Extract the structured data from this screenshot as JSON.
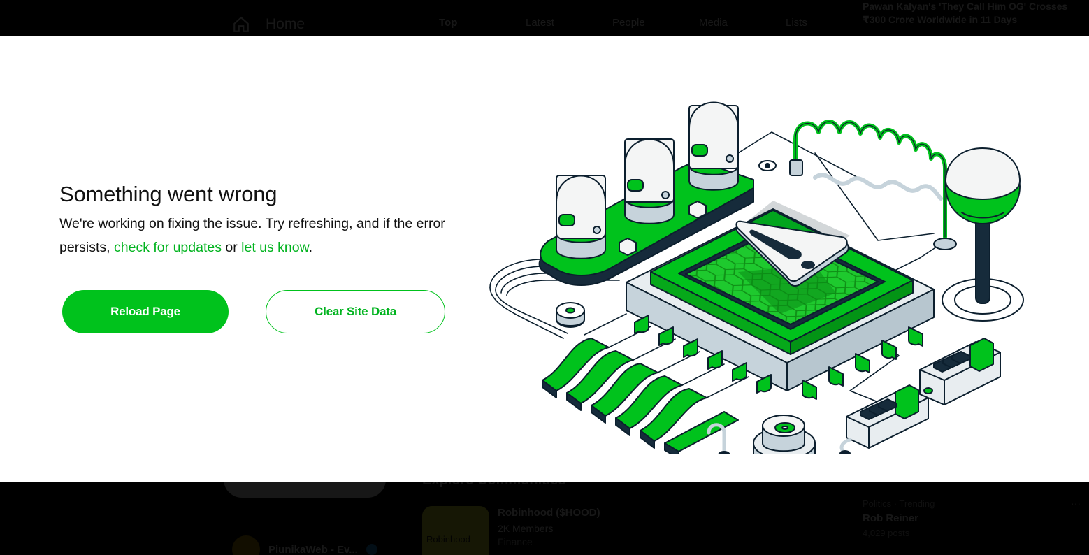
{
  "background": {
    "nav": {
      "home_label": "Home"
    },
    "search_tabs": [
      {
        "label": "Top",
        "active": true
      },
      {
        "label": "Latest",
        "active": false
      },
      {
        "label": "People",
        "active": false
      },
      {
        "label": "Media",
        "active": false
      },
      {
        "label": "Lists",
        "active": false
      }
    ],
    "trend_headline": "Pawan Kalyan's 'They Call Him OG' Crosses ₹300 Crore Worldwide in 11 Days",
    "explore_heading": "Explore Communities",
    "community": {
      "image_text": "Robinhood",
      "name": "Robinhood ($HOOD)",
      "members": "2K Members",
      "category": "Finance"
    },
    "trend": {
      "context": "Politics · Trending",
      "name": "Rob Reiner",
      "posts": "4,029 posts",
      "more": "···"
    },
    "account": {
      "name": "PiunikaWeb - Ev..."
    }
  },
  "error": {
    "title": "Something went wrong",
    "message_part1": "We're working on fixing the issue. Try refreshing, and if the error persists, ",
    "link_updates": "check for updates",
    "message_part2": " or ",
    "link_contact": "let us know",
    "message_part3": ".",
    "reload_label": "Reload Page",
    "clear_label": "Clear Site Data"
  },
  "colors": {
    "accent": "#00c21c",
    "link": "#00b31e",
    "panel": "#ffffff",
    "backdrop": "#000000"
  }
}
